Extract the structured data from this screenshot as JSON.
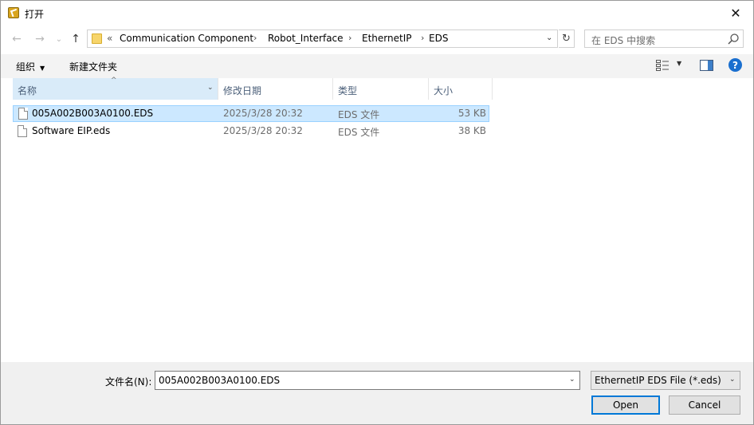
{
  "window": {
    "title": "打开",
    "close_glyph": "✕",
    "icon": "app-icon"
  },
  "nav": {
    "back_glyph": "←",
    "forward_glyph": "→",
    "recent_glyph": "⌄",
    "up_glyph": "↑",
    "overflow_glyph": "«",
    "breadcrumbs": [
      "Communication Component",
      "Robot_Interface",
      "EthernetIP",
      "EDS"
    ],
    "separator_glyph": "›",
    "dropdown_glyph": "⌄",
    "refresh_glyph": "↻"
  },
  "search": {
    "placeholder": "在 EDS 中搜索"
  },
  "toolbar": {
    "organize_label": "组织",
    "organize_caret": "▼",
    "new_folder_label": "新建文件夹",
    "view_caret": "▼",
    "help_glyph": "?"
  },
  "columns": {
    "name": "名称",
    "modified": "修改日期",
    "type": "类型",
    "size": "大小",
    "sort_glyph": "^",
    "dropdown_glyph": "⌄"
  },
  "files": [
    {
      "name": "005A002B003A0100.EDS",
      "modified": "2025/3/28 20:32",
      "type": "EDS 文件",
      "size": "53 KB",
      "selected": true
    },
    {
      "name": "Software EIP.eds",
      "modified": "2025/3/28 20:32",
      "type": "EDS 文件",
      "size": "38 KB",
      "selected": false
    }
  ],
  "footer": {
    "filename_label": "文件名(N):",
    "filename_value": "005A002B003A0100.EDS",
    "filename_dropdown_glyph": "⌄",
    "filetype_value": "EthernetIP EDS File (*.eds)",
    "filetype_dropdown_glyph": "⌄",
    "open_label": "Open",
    "cancel_label": "Cancel"
  },
  "colors": {
    "selected_row": "#cce8ff",
    "selected_border": "#99d1ff",
    "sorted_header": "#d9ebf9",
    "accent": "#0078d7",
    "folder": "#f7d56b"
  }
}
